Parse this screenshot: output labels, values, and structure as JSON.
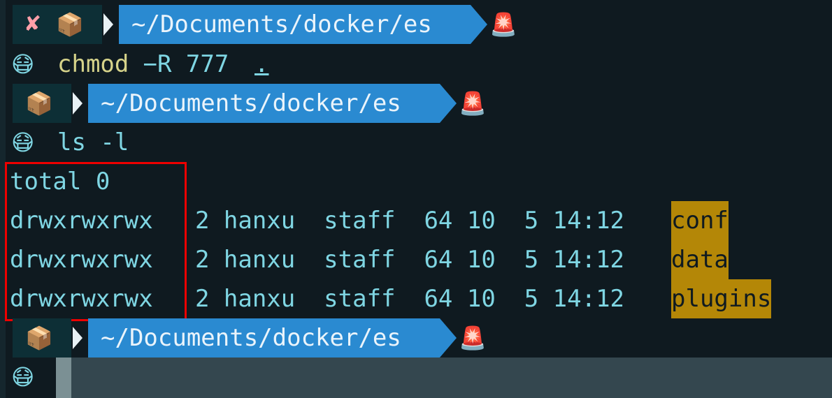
{
  "prompt": {
    "fail_icon": "✘",
    "box_icon": "📦",
    "alarm_icon": "🚨",
    "cwd": "~/Documents/docker/es"
  },
  "user_icon": "😷",
  "commands": [
    {
      "cmd": "chmod",
      "args": " −R 777 ",
      "path": "."
    },
    {
      "cmd": "ls -l"
    }
  ],
  "output": {
    "total": "total 0",
    "rows": [
      {
        "perms": "drwxrwxrwx",
        "info": "  2 hanxu  staff  64 10  5 14:12 ",
        "name": "conf"
      },
      {
        "perms": "drwxrwxrwx",
        "info": "  2 hanxu  staff  64 10  5 14:12 ",
        "name": "data"
      },
      {
        "perms": "drwxrwxrwx",
        "info": "  2 hanxu  staff  64 10  5 14:12 ",
        "name": "plugins"
      }
    ]
  }
}
